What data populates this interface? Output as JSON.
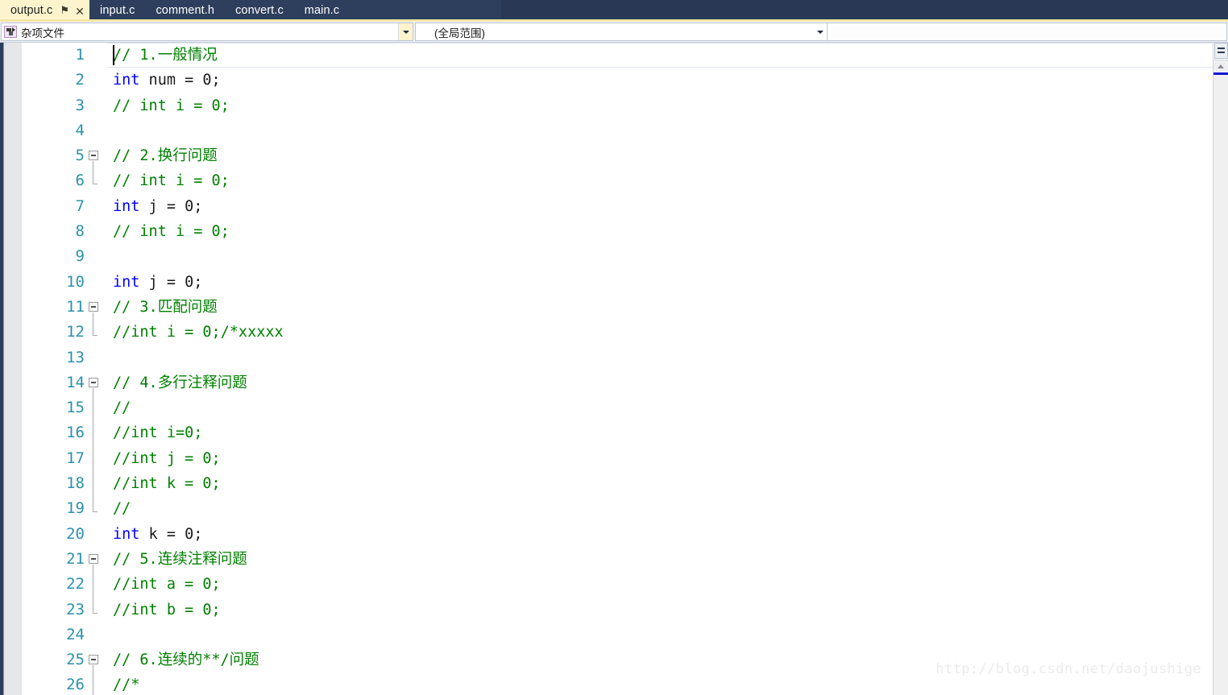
{
  "tabs": [
    {
      "label": "output.c",
      "active": true,
      "pin_icon": "pin-icon",
      "close_icon": "close-icon"
    },
    {
      "label": "input.c",
      "active": false
    },
    {
      "label": "comment.h",
      "active": false
    },
    {
      "label": "convert.c",
      "active": false
    },
    {
      "label": "main.c",
      "active": false
    }
  ],
  "navbar": {
    "project_combo": {
      "value": "杂项文件",
      "icon": "file-document-icon",
      "arrow_icon": "chevron-down-icon"
    },
    "scope_combo": {
      "value": "(全局范围)",
      "arrow_icon": "chevron-down-icon"
    }
  },
  "editor": {
    "caret_line": 1,
    "watermark": "http://blog.csdn.net/daojushige",
    "colors": {
      "keyword": "#0000ff",
      "comment": "#008000",
      "plain": "#1a1a1a",
      "line_number": "#2b91af",
      "active_tab_bg": "#fdf4ce",
      "tabstrip_bg": "#293955"
    },
    "lines": [
      {
        "n": "1",
        "fold": "none",
        "tokens": [
          {
            "t": "// 1.一般情况",
            "c": "cmt"
          }
        ]
      },
      {
        "n": "2",
        "fold": "none",
        "tokens": [
          {
            "t": "int",
            "c": "kw"
          },
          {
            "t": " num = 0;",
            "c": "plain"
          }
        ]
      },
      {
        "n": "3",
        "fold": "none",
        "tokens": [
          {
            "t": "// int i = 0;",
            "c": "cmt"
          }
        ]
      },
      {
        "n": "4",
        "fold": "none",
        "tokens": [
          {
            "t": "",
            "c": "plain"
          }
        ]
      },
      {
        "n": "5",
        "fold": "open",
        "tokens": [
          {
            "t": "// 2.换行问题",
            "c": "cmt"
          }
        ]
      },
      {
        "n": "6",
        "fold": "end",
        "tokens": [
          {
            "t": "// int i = 0;",
            "c": "cmt"
          }
        ]
      },
      {
        "n": "7",
        "fold": "none",
        "tokens": [
          {
            "t": "int",
            "c": "kw"
          },
          {
            "t": " j = 0;",
            "c": "plain"
          }
        ]
      },
      {
        "n": "8",
        "fold": "none",
        "tokens": [
          {
            "t": "// int i = 0;",
            "c": "cmt"
          }
        ]
      },
      {
        "n": "9",
        "fold": "none",
        "tokens": [
          {
            "t": "",
            "c": "plain"
          }
        ]
      },
      {
        "n": "10",
        "fold": "none",
        "tokens": [
          {
            "t": "int",
            "c": "kw"
          },
          {
            "t": " j = 0;",
            "c": "plain"
          }
        ]
      },
      {
        "n": "11",
        "fold": "open",
        "tokens": [
          {
            "t": "// 3.匹配问题",
            "c": "cmt"
          }
        ]
      },
      {
        "n": "12",
        "fold": "end",
        "tokens": [
          {
            "t": "//int i = 0;/*xxxxx",
            "c": "cmt"
          }
        ]
      },
      {
        "n": "13",
        "fold": "none",
        "tokens": [
          {
            "t": "",
            "c": "plain"
          }
        ]
      },
      {
        "n": "14",
        "fold": "open",
        "tokens": [
          {
            "t": "// 4.多行注释问题",
            "c": "cmt"
          }
        ]
      },
      {
        "n": "15",
        "fold": "mid",
        "tokens": [
          {
            "t": "//",
            "c": "cmt"
          }
        ]
      },
      {
        "n": "16",
        "fold": "mid",
        "tokens": [
          {
            "t": "//int i=0;",
            "c": "cmt"
          }
        ]
      },
      {
        "n": "17",
        "fold": "mid",
        "tokens": [
          {
            "t": "//int j = 0;",
            "c": "cmt"
          }
        ]
      },
      {
        "n": "18",
        "fold": "mid",
        "tokens": [
          {
            "t": "//int k = 0;",
            "c": "cmt"
          }
        ]
      },
      {
        "n": "19",
        "fold": "end",
        "tokens": [
          {
            "t": "//",
            "c": "cmt"
          }
        ]
      },
      {
        "n": "20",
        "fold": "none",
        "tokens": [
          {
            "t": "int",
            "c": "kw"
          },
          {
            "t": " k = 0;",
            "c": "plain"
          }
        ]
      },
      {
        "n": "21",
        "fold": "open",
        "tokens": [
          {
            "t": "// 5.连续注释问题",
            "c": "cmt"
          }
        ]
      },
      {
        "n": "22",
        "fold": "mid",
        "tokens": [
          {
            "t": "//int a = 0;",
            "c": "cmt"
          }
        ]
      },
      {
        "n": "23",
        "fold": "end",
        "tokens": [
          {
            "t": "//int b = 0;",
            "c": "cmt"
          }
        ]
      },
      {
        "n": "24",
        "fold": "none",
        "tokens": [
          {
            "t": "",
            "c": "plain"
          }
        ]
      },
      {
        "n": "25",
        "fold": "open",
        "tokens": [
          {
            "t": "// 6.连续的**/问题",
            "c": "cmt"
          }
        ]
      },
      {
        "n": "26",
        "fold": "mid",
        "tokens": [
          {
            "t": "//*",
            "c": "cmt"
          }
        ]
      }
    ]
  },
  "scrollbar": {
    "up_arrow_icon": "chevron-up-icon",
    "marker_color": "#1414d2",
    "split_icon": "split-view-icon"
  }
}
